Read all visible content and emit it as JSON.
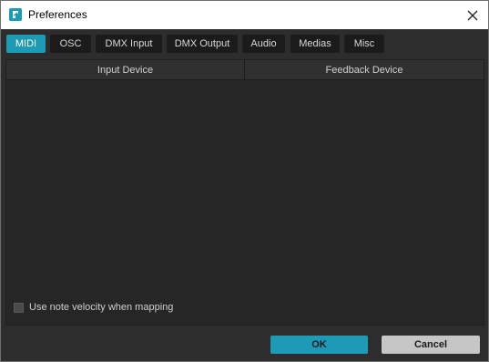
{
  "window": {
    "title": "Preferences",
    "accent_color": "#1d9bb6",
    "icons": {
      "app": "app-logo-icon",
      "close": "close-icon"
    }
  },
  "tabs": [
    {
      "label": "MIDI",
      "active": true
    },
    {
      "label": "OSC",
      "active": false
    },
    {
      "label": "DMX Input",
      "active": false
    },
    {
      "label": "DMX Output",
      "active": false
    },
    {
      "label": "Audio",
      "active": false
    },
    {
      "label": "Medias",
      "active": false
    },
    {
      "label": "Misc",
      "active": false
    }
  ],
  "midi_panel": {
    "columns": [
      "Input Device",
      "Feedback Device"
    ],
    "rows": [],
    "velocity_checkbox": {
      "label": "Use note velocity when mapping",
      "checked": false
    }
  },
  "footer": {
    "ok_label": "OK",
    "cancel_label": "Cancel"
  }
}
